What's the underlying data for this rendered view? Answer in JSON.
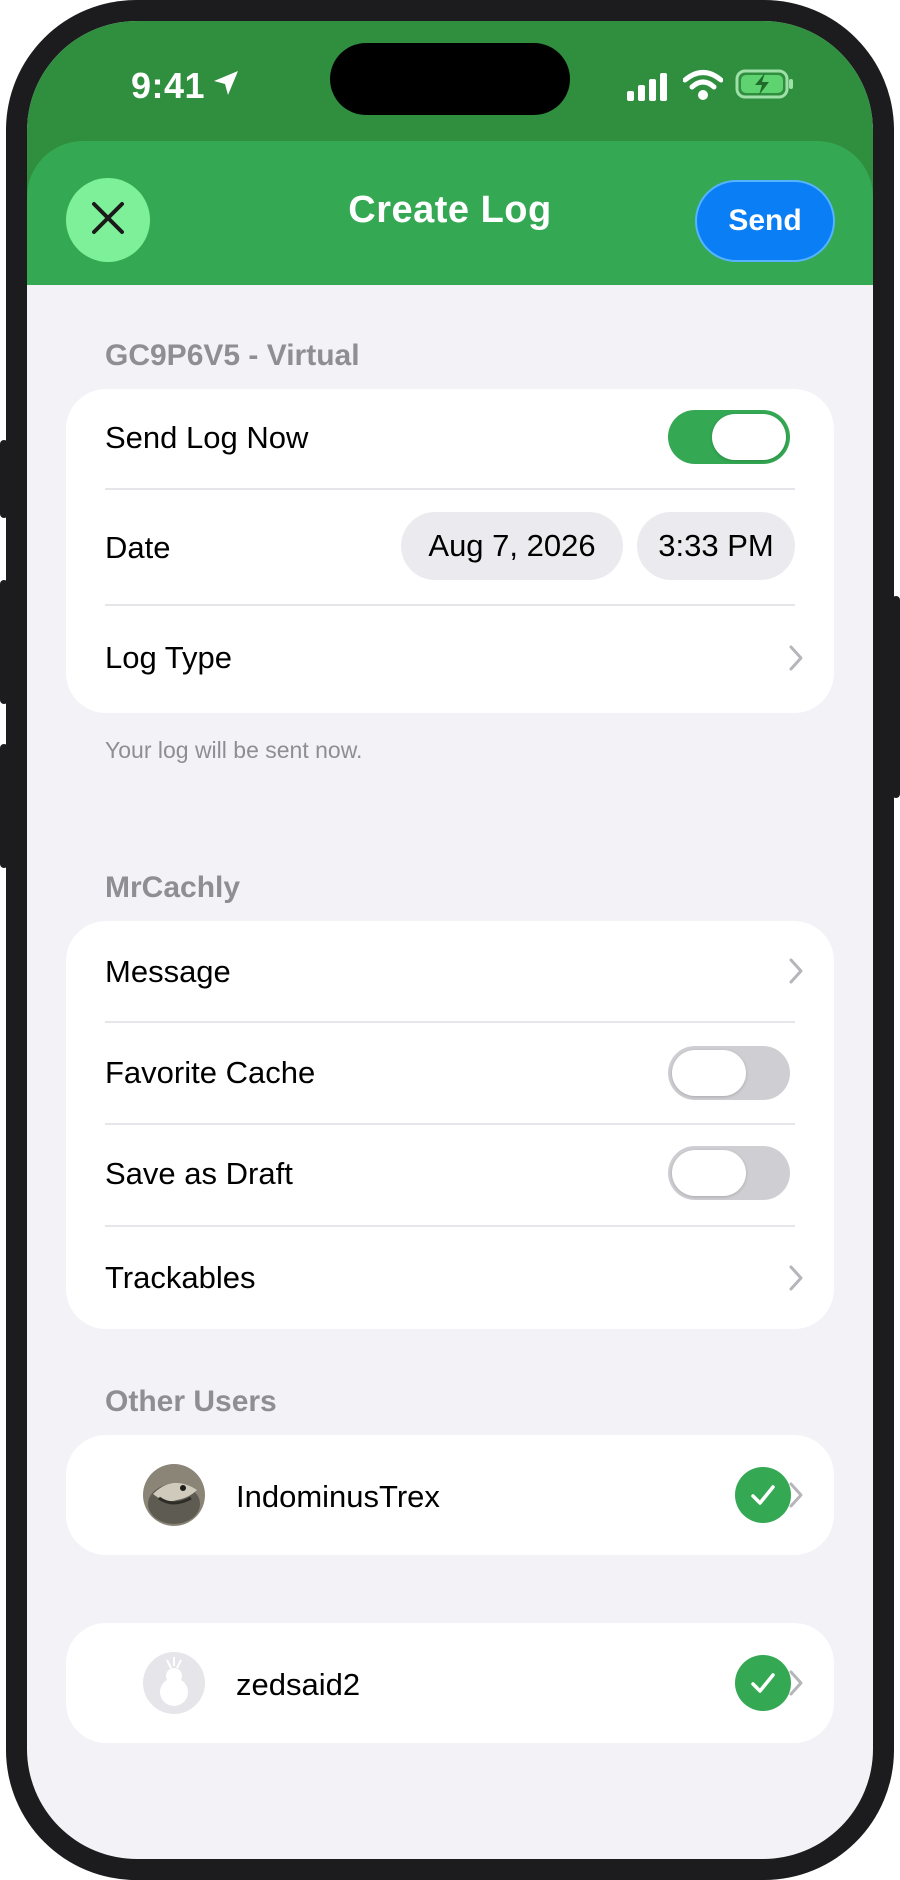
{
  "status_bar": {
    "time": "9:41"
  },
  "header": {
    "title": "Create Log",
    "send_label": "Send"
  },
  "cache_section": {
    "label": "GC9P6V5 - Virtual",
    "send_log_now_label": "Send Log Now",
    "send_log_now_on": true,
    "date_label": "Date",
    "date_value": "Aug 7, 2026",
    "time_value": "3:33 PM",
    "log_type_label": "Log Type",
    "footnote": "Your log will be sent now."
  },
  "user_section": {
    "label": "MrCachly",
    "message_label": "Message",
    "favorite_label": "Favorite Cache",
    "favorite_on": false,
    "draft_label": "Save as Draft",
    "draft_on": false,
    "trackables_label": "Trackables"
  },
  "other_users": {
    "label": "Other Users",
    "users": [
      {
        "name": "IndominusTrex",
        "checked": true
      },
      {
        "name": "zedsaid2",
        "checked": true
      }
    ]
  },
  "colors": {
    "header_green": "#34a853",
    "status_green": "#2f8f3f",
    "send_blue": "#0a7ff5",
    "close_bg": "#7ff09a",
    "background": "#f2f2f7"
  }
}
